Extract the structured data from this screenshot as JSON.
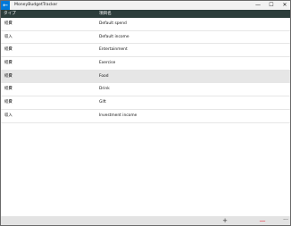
{
  "window": {
    "title": "MoneyBudgetTracker",
    "back_icon": "←",
    "minimize_icon": "—",
    "maximize_icon": "☐",
    "close_icon": "✕"
  },
  "table": {
    "headers": [
      "タイプ",
      "項目名"
    ],
    "rows": [
      {
        "type": "経費",
        "name": "Default spend"
      },
      {
        "type": "収入",
        "name": "Default income"
      },
      {
        "type": "経費",
        "name": "Entertainment"
      },
      {
        "type": "経費",
        "name": "Exercise"
      },
      {
        "type": "経費",
        "name": "Food"
      },
      {
        "type": "経費",
        "name": "Drink"
      },
      {
        "type": "経費",
        "name": "Gift"
      },
      {
        "type": "収入",
        "name": "Investment income"
      }
    ],
    "selected_row": "Food"
  },
  "commandbar": {
    "add_icon": "+",
    "delete_icon": "—",
    "more_icon": "···"
  }
}
